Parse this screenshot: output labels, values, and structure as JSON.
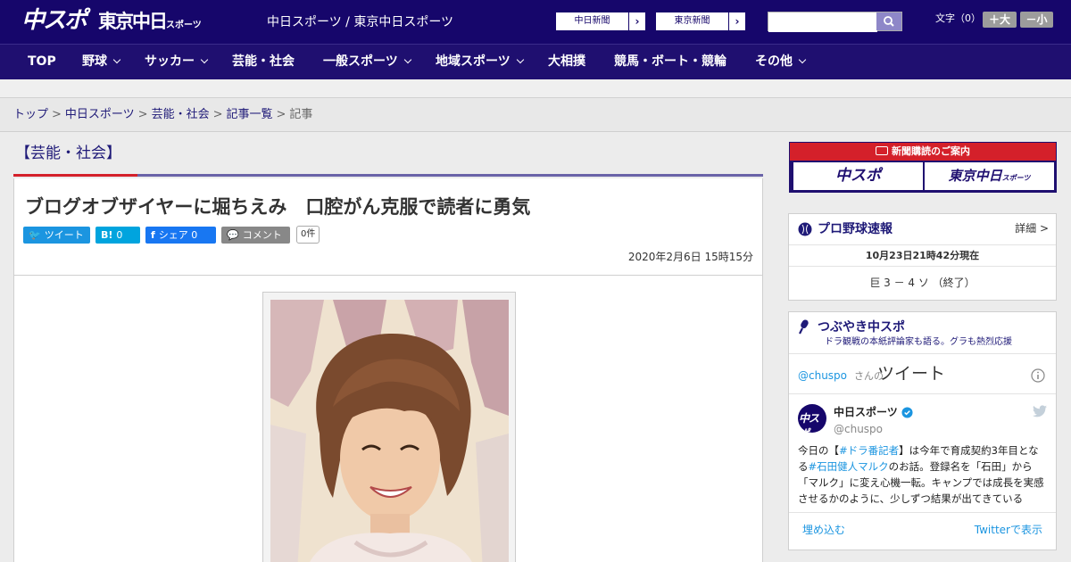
{
  "header": {
    "logo_chuspo": "中スポ",
    "logo_tokyo": "東京中日",
    "logo_tokyo_sub": "スポーツ",
    "site_links": "中日スポーツ / 東京中日スポーツ",
    "paper_links": [
      {
        "label": "中日新聞"
      },
      {
        "label": "東京新聞"
      }
    ],
    "search": {
      "value": "",
      "placeholder": ""
    },
    "text_size_label": "文字（0）",
    "size_up": "＋大",
    "size_down": "－小"
  },
  "nav": [
    {
      "label": "TOP",
      "dropdown": false
    },
    {
      "label": "野球",
      "dropdown": true
    },
    {
      "label": "サッカー",
      "dropdown": true
    },
    {
      "label": "芸能・社会",
      "dropdown": false
    },
    {
      "label": "一般スポーツ",
      "dropdown": true
    },
    {
      "label": "地域スポーツ",
      "dropdown": true
    },
    {
      "label": "大相撲",
      "dropdown": false
    },
    {
      "label": "競馬・ボート・競輪",
      "dropdown": false
    },
    {
      "label": "その他",
      "dropdown": true
    }
  ],
  "breadcrumb": {
    "items": [
      "トップ",
      "中日スポーツ",
      "芸能・社会",
      "記事一覧"
    ],
    "current": "記事"
  },
  "category_title": "【芸能・社会】",
  "article": {
    "title": "ブログオブザイヤーに堀ちえみ　口腔がん克服で読者に勇気",
    "share": {
      "tweet": "ツイート",
      "hatena": "B!",
      "hatena_count": "0",
      "facebook": "シェア",
      "facebook_count": "0",
      "comment": "コメント",
      "comment_count": "0件"
    },
    "date": "2020年2月6日 15時15分"
  },
  "sidebar": {
    "promo": {
      "title": "新聞購読のご案内",
      "left": "中スポ",
      "right": "東京中日",
      "right_sub": "スポーツ"
    },
    "baseball": {
      "title": "プロ野球速報",
      "detail": "詳細 >",
      "time": "10月23日21時42分現在",
      "score": "巨 3 － 4 ソ （終了）"
    },
    "tweets": {
      "title": "つぶやき中スポ",
      "subtitle": "ドラ観戦の本紙評論家も語る。グラも熱烈応援",
      "header_handle": "@chuspo",
      "header_suffix": "さんの",
      "header_label": "ツイート",
      "account_name": "中日スポーツ",
      "account_handle": "@chuspo",
      "body": {
        "p1": "今日の【",
        "tag1": "#ドラ番記者",
        "p2": "】は今年で育成契約3年目となる",
        "tag2": "#石田健人マルク",
        "p3": "のお話。登録名を「石田」から「マルク」に変え心機一転。キャンプでは成長を実感させるかのように、少しずつ結果が出てきている"
      },
      "embed": "埋め込む",
      "view": "Twitterで表示"
    }
  },
  "colors": {
    "brand_navy": "#16066b",
    "nav_bg": "#1f0f70",
    "accent_red": "#d4202a",
    "twitter": "#1b95e0",
    "facebook": "#1877f2",
    "hatena": "#00a4de",
    "comment_gray": "#888888"
  },
  "icons": [
    "search-icon",
    "chevron-down-icon",
    "twitter-bird-icon",
    "facebook-icon",
    "comment-bubble-icon",
    "baseball-icon",
    "microphone-icon",
    "verified-badge-icon",
    "info-icon",
    "newspaper-icon"
  ]
}
